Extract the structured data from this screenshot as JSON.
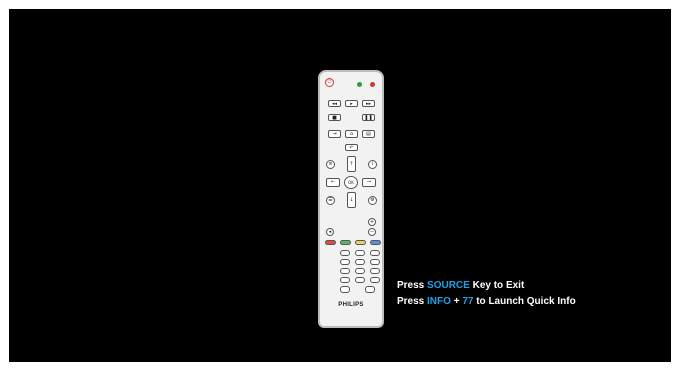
{
  "remote": {
    "brand": "PHILIPS",
    "icons": {
      "power": "power-icon",
      "home": "home-icon",
      "ok": "OK"
    }
  },
  "message": {
    "line1_prefix": "Press ",
    "line1_key": "SOURCE",
    "line1_suffix": " Key to Exit",
    "line2_prefix": "Press ",
    "line2_key1": "INFO",
    "line2_plus": " + ",
    "line2_key2": "77",
    "line2_suffix": " to Launch Quick Info"
  },
  "colors": {
    "background": "#000000",
    "highlight": "#1aa3e8",
    "text": "#ffffff"
  }
}
